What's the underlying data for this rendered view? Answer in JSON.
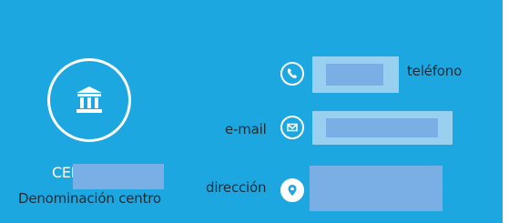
{
  "school": {
    "prefix": "CEIP",
    "denomination_label": "Denominación centro"
  },
  "contact": {
    "phone_label": "teléfono",
    "email_label": "e-mail",
    "address_label": "dirección"
  },
  "colors": {
    "panel_background": "#1da7e1",
    "redacted_field": "#7aafe6",
    "field_highlight": "#9ad0ef",
    "dark_text": "#1d2b35"
  },
  "icons": [
    "building-icon",
    "phone-icon",
    "envelope-icon",
    "location-pin-icon"
  ]
}
